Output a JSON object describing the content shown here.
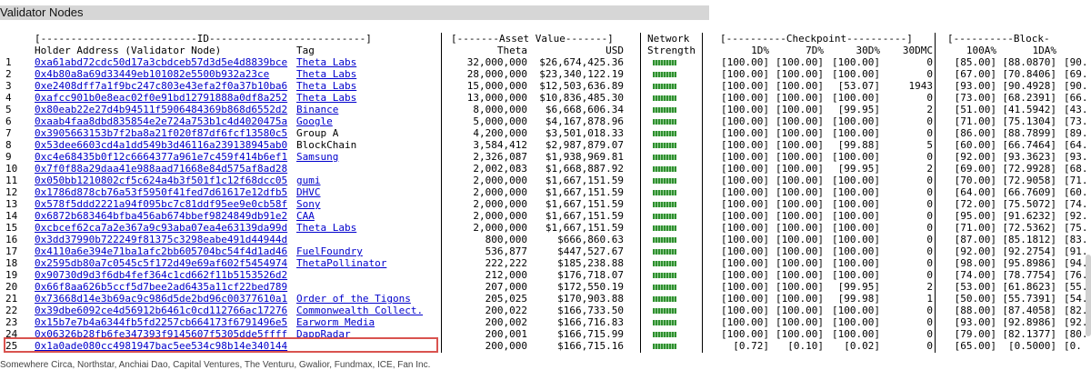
{
  "section_title": "Validator Nodes",
  "headers": {
    "id_group": "[--------------------------ID--------------------------]",
    "asset_group": "[-------Asset Value-------]",
    "network_group": "Network",
    "network_sub": "Strength",
    "checkpoint_group": "[----------Checkpoint----------]",
    "block_group": "[----------Block-",
    "holder": "Holder Address (Validator Node)",
    "tag": "Tag",
    "theta": "Theta",
    "usd": "USD",
    "c1d": "1D%",
    "c7d": "7D%",
    "c30d": "30D%",
    "c30dmc": "30DMC",
    "b100a": "100A%",
    "b1da": "1DA%"
  },
  "rows": [
    {
      "n": "1",
      "addr": "0xa61abd72cdc50d17a3cbdceb57d3d5e4d8839bce",
      "tag": "Theta Labs",
      "tag_link": true,
      "theta": "32,000,000",
      "usd": "$26,674,425.36",
      "d1": "[100.00]",
      "d7": "[100.00]",
      "d30": "[100.00]",
      "mc": "0",
      "a100": "[85.00]",
      "a1d": "[88.0870]",
      "tr": "[90."
    },
    {
      "n": "2",
      "addr": "0x4b80a8a69d33449eb101082e5500b932a23ce",
      "tag": "Theta Labs",
      "tag_link": true,
      "theta": "28,000,000",
      "usd": "$23,340,122.19",
      "d1": "[100.00]",
      "d7": "[100.00]",
      "d30": "[100.00]",
      "mc": "0",
      "a100": "[67.00]",
      "a1d": "[70.8406]",
      "tr": "[69."
    },
    {
      "n": "3",
      "addr": "0xe2408dff7a1f9bc247c803e43efa2f0a37b10ba6",
      "tag": "Theta Labs",
      "tag_link": true,
      "theta": "15,000,000",
      "usd": "$12,503,636.89",
      "d1": "[100.00]",
      "d7": "[100.00]",
      "d30": "[53.07]",
      "mc": "1943",
      "a100": "[93.00]",
      "a1d": "[90.4928]",
      "tr": "[90."
    },
    {
      "n": "4",
      "addr": "0xafcc901b0e8eac02f0e91bd12791888a0df8a252",
      "tag": "Theta Labs",
      "tag_link": true,
      "theta": "13,000,000",
      "usd": "$10,836,485.30",
      "d1": "[100.00]",
      "d7": "[100.00]",
      "d30": "[100.00]",
      "mc": "0",
      "a100": "[73.00]",
      "a1d": "[68.2391]",
      "tr": "[66."
    },
    {
      "n": "5",
      "addr": "0x80eab22e27d4b94511f5906484369b868d6552d2",
      "tag": "Binance",
      "tag_link": true,
      "theta": "8,000,000",
      "usd": "$6,668,606.34",
      "d1": "[100.00]",
      "d7": "[100.00]",
      "d30": "[99.95]",
      "mc": "2",
      "a100": "[51.00]",
      "a1d": "[41.5942]",
      "tr": "[43."
    },
    {
      "n": "6",
      "addr": "0xaab4faa8dbd835854e2e724a753b1c4d4020475a",
      "tag": "Google",
      "tag_link": true,
      "theta": "5,000,000",
      "usd": "$4,167,878.96",
      "d1": "[100.00]",
      "d7": "[100.00]",
      "d30": "[100.00]",
      "mc": "0",
      "a100": "[71.00]",
      "a1d": "[75.1304]",
      "tr": "[73."
    },
    {
      "n": "7",
      "addr": "0x3905663153b7f2ba8a21f020f87df6fcf13580c5",
      "tag": "Group A",
      "tag_link": false,
      "theta": "4,200,000",
      "usd": "$3,501,018.33",
      "d1": "[100.00]",
      "d7": "[100.00]",
      "d30": "[100.00]",
      "mc": "0",
      "a100": "[86.00]",
      "a1d": "[88.7899]",
      "tr": "[89."
    },
    {
      "n": "8",
      "addr": "0x53dee6603cd4a1dd549b3d46116a239138945ab0",
      "tag": "BlockChain",
      "tag_link": false,
      "theta": "3,584,412",
      "usd": "$2,987,879.07",
      "d1": "[100.00]",
      "d7": "[100.00]",
      "d30": "[99.88]",
      "mc": "5",
      "a100": "[60.00]",
      "a1d": "[66.7464]",
      "tr": "[64."
    },
    {
      "n": "9",
      "addr": "0xc4e68435b0f12c6664377a961e7c459f414b6ef1",
      "tag": "Samsung",
      "tag_link": true,
      "theta": "2,326,087",
      "usd": "$1,938,969.81",
      "d1": "[100.00]",
      "d7": "[100.00]",
      "d30": "[100.00]",
      "mc": "0",
      "a100": "[92.00]",
      "a1d": "[93.3623]",
      "tr": "[93."
    },
    {
      "n": "10",
      "addr": "0x7f0f88a29daa41e988aad71668e84d575af8ad28",
      "tag": "",
      "tag_link": false,
      "theta": "2,002,083",
      "usd": "$1,668,887.92",
      "d1": "[100.00]",
      "d7": "[100.00]",
      "d30": "[99.95]",
      "mc": "2",
      "a100": "[69.00]",
      "a1d": "[72.9928]",
      "tr": "[68."
    },
    {
      "n": "11",
      "addr": "0x050bb1210802cf5c624a4b3f501f1c12f68dcc05",
      "tag": "gumi",
      "tag_link": true,
      "theta": "2,000,000",
      "usd": "$1,667,151.59",
      "d1": "[100.00]",
      "d7": "[100.00]",
      "d30": "[100.00]",
      "mc": "0",
      "a100": "[70.00]",
      "a1d": "[72.9058]",
      "tr": "[71."
    },
    {
      "n": "12",
      "addr": "0x1786d878cb76a53f5950f41fed7d61617e12dfb5",
      "tag": "DHVC",
      "tag_link": true,
      "theta": "2,000,000",
      "usd": "$1,667,151.59",
      "d1": "[100.00]",
      "d7": "[100.00]",
      "d30": "[100.00]",
      "mc": "0",
      "a100": "[64.00]",
      "a1d": "[66.7609]",
      "tr": "[60."
    },
    {
      "n": "13",
      "addr": "0x578f5ddd2221a94f095bc7c81ddf95ee9e0cb58f",
      "tag": "Sony",
      "tag_link": true,
      "theta": "2,000,000",
      "usd": "$1,667,151.59",
      "d1": "[100.00]",
      "d7": "[100.00]",
      "d30": "[100.00]",
      "mc": "0",
      "a100": "[72.00]",
      "a1d": "[75.5072]",
      "tr": "[74."
    },
    {
      "n": "14",
      "addr": "0x6872b683464bfba456ab674bbef9824849db91e2",
      "tag": "CAA",
      "tag_link": true,
      "theta": "2,000,000",
      "usd": "$1,667,151.59",
      "d1": "[100.00]",
      "d7": "[100.00]",
      "d30": "[100.00]",
      "mc": "0",
      "a100": "[95.00]",
      "a1d": "[91.6232]",
      "tr": "[92."
    },
    {
      "n": "15",
      "addr": "0xcbcef62ca7a2e367a9c93aba07ea4e63139da99d",
      "tag": "Theta Labs",
      "tag_link": true,
      "theta": "2,000,000",
      "usd": "$1,667,151.59",
      "d1": "[100.00]",
      "d7": "[100.00]",
      "d30": "[100.00]",
      "mc": "0",
      "a100": "[71.00]",
      "a1d": "[72.5362]",
      "tr": "[75."
    },
    {
      "n": "16",
      "addr": "0x3dd37990b722249f81375c3298eabe491d44944d",
      "tag": "",
      "tag_link": false,
      "theta": "800,000",
      "usd": "$666,860.63",
      "d1": "[100.00]",
      "d7": "[100.00]",
      "d30": "[100.00]",
      "mc": "0",
      "a100": "[87.00]",
      "a1d": "[85.1812]",
      "tr": "[83."
    },
    {
      "n": "17",
      "addr": "0x4110a6e394e71ba1afc2bb605704bc54f4d1ad46",
      "tag": "FuelFoundry",
      "tag_link": true,
      "theta": "536,877",
      "usd": "$447,527.67",
      "d1": "[100.00]",
      "d7": "[100.00]",
      "d30": "[100.00]",
      "mc": "0",
      "a100": "[92.00]",
      "a1d": "[92.2754]",
      "tr": "[91."
    },
    {
      "n": "18",
      "addr": "0x2595db80a7c0545c5f172d49e69af602f5454974",
      "tag": "ThetaPollinator",
      "tag_link": true,
      "theta": "222,222",
      "usd": "$185,238.88",
      "d1": "[100.00]",
      "d7": "[100.00]",
      "d30": "[100.00]",
      "mc": "0",
      "a100": "[98.00]",
      "a1d": "[95.8986]",
      "tr": "[94."
    },
    {
      "n": "19",
      "addr": "0x90730d9d3f6db4fef364c1cd662f11b5153526d2",
      "tag": "",
      "tag_link": false,
      "theta": "212,000",
      "usd": "$176,718.07",
      "d1": "[100.00]",
      "d7": "[100.00]",
      "d30": "[100.00]",
      "mc": "0",
      "a100": "[74.00]",
      "a1d": "[78.7754]",
      "tr": "[76."
    },
    {
      "n": "20",
      "addr": "0x66f8aa626b5ccf5d7bee2ad6435a11cf22bed789",
      "tag": "",
      "tag_link": false,
      "theta": "207,000",
      "usd": "$172,550.19",
      "d1": "[100.00]",
      "d7": "[100.00]",
      "d30": "[99.95]",
      "mc": "2",
      "a100": "[53.00]",
      "a1d": "[61.8623]",
      "tr": "[55."
    },
    {
      "n": "21",
      "addr": "0x73668d14e3b69ac9c986d5de2bd96c00377610a1",
      "tag": "Order of the Tigons",
      "tag_link": true,
      "theta": "205,025",
      "usd": "$170,903.88",
      "d1": "[100.00]",
      "d7": "[100.00]",
      "d30": "[99.98]",
      "mc": "1",
      "a100": "[50.00]",
      "a1d": "[55.7391]",
      "tr": "[54."
    },
    {
      "n": "22",
      "addr": "0x39dbe6092ce4d56912b6461c0cd112766ac17276",
      "tag": "Commonwealth Collect.",
      "tag_link": true,
      "theta": "200,022",
      "usd": "$166,733.50",
      "d1": "[100.00]",
      "d7": "[100.00]",
      "d30": "[100.00]",
      "mc": "0",
      "a100": "[88.00]",
      "a1d": "[87.4058]",
      "tr": "[82."
    },
    {
      "n": "23",
      "addr": "0x15b7e7b4a6344fb5fd2257cb664173f6791496e5",
      "tag": "Earworm Media",
      "tag_link": true,
      "theta": "200,002",
      "usd": "$166,716.83",
      "d1": "[100.00]",
      "d7": "[100.00]",
      "d30": "[100.00]",
      "mc": "0",
      "a100": "[93.00]",
      "a1d": "[92.8986]",
      "tr": "[92."
    },
    {
      "n": "24",
      "addr": "0x06326b28fb6fe347393f9145607f5305dde5ffff",
      "tag": "DappRadar",
      "tag_link": true,
      "theta": "200,001",
      "usd": "$166,715.99",
      "d1": "[100.00]",
      "d7": "[100.00]",
      "d30": "[100.00]",
      "mc": "0",
      "a100": "[79.00]",
      "a1d": "[82.1377]",
      "tr": "[80."
    },
    {
      "n": "25",
      "addr": "0x1a0ade080cc4981947bac5ee534c98b14e340144",
      "tag": "",
      "tag_link": false,
      "theta": "200,000",
      "usd": "$166,715.16",
      "d1": "[0.72]",
      "d7": "[0.10]",
      "d30": "[0.02]",
      "mc": "0",
      "a100": "[65.00]",
      "a1d": "[0.5000]",
      "tr": "[0."
    }
  ],
  "footer_text": "Somewhere Circa, Northstar, Anchiai Dao, Capital Ventures, The Venturu, Gwalior, Fundmax, ICE, Fan Inc."
}
